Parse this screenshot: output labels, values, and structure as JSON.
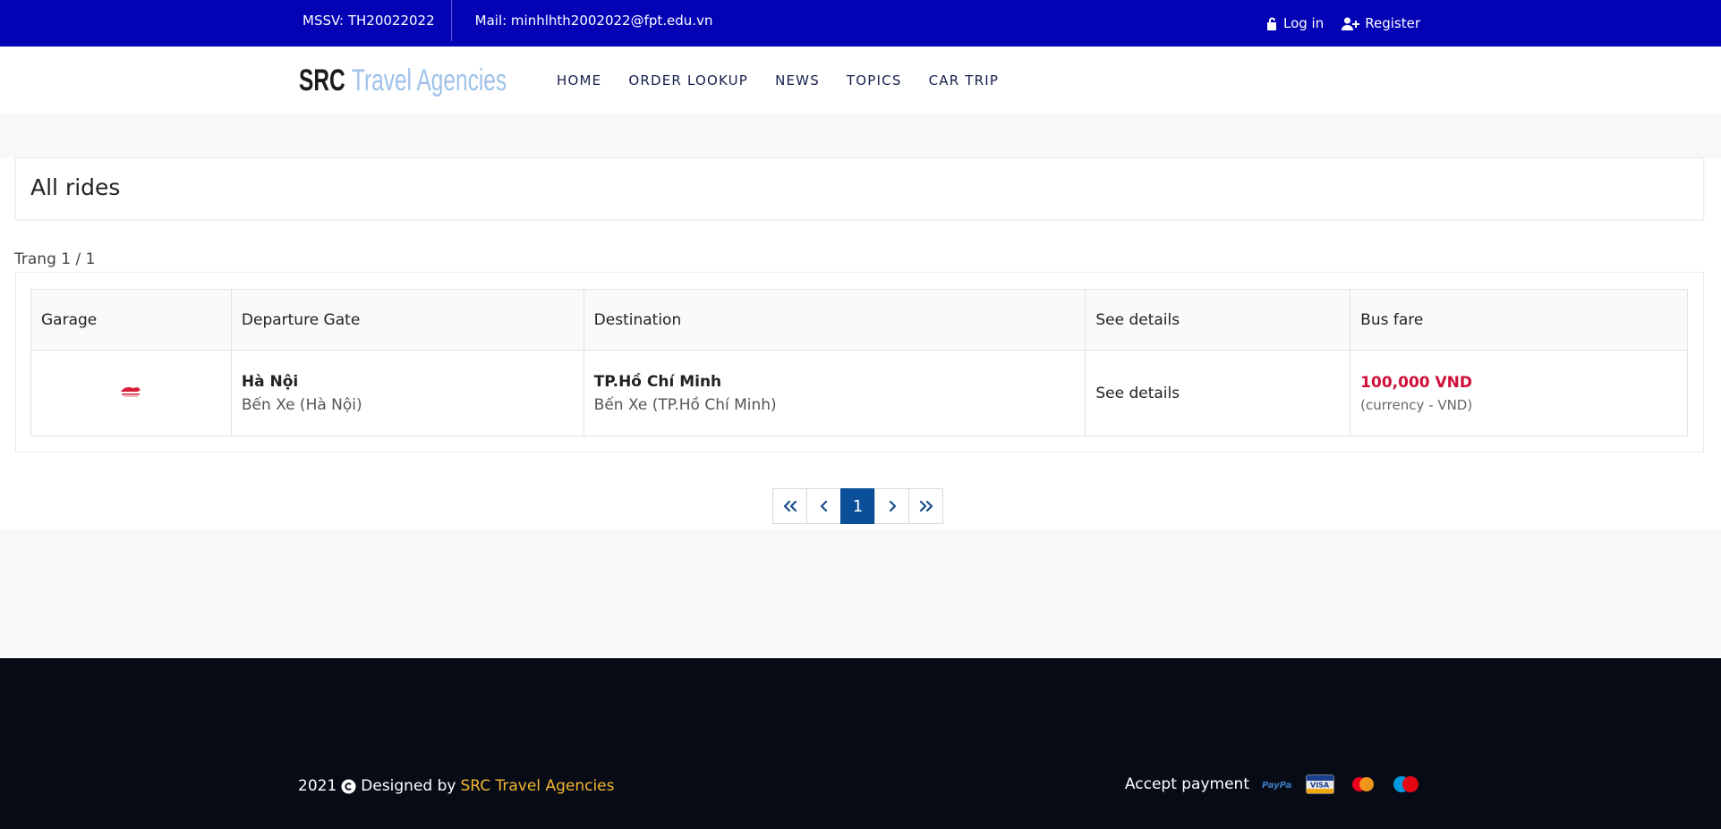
{
  "topbar": {
    "mssv": "MSSV: TH20022022",
    "mail": "Mail: minhlhth2002022@fpt.edu.vn",
    "login_label": "Log in",
    "register_label": "Register"
  },
  "header": {
    "logo_part1": "SRC",
    "logo_part2": "Travel Agencies",
    "nav": [
      "HOME",
      "ORDER LOOKUP",
      "NEWS",
      "TOPICS",
      "CAR TRIP"
    ]
  },
  "main": {
    "title": "All rides",
    "page_info": "Trang 1 / 1",
    "table": {
      "headers": [
        "Garage",
        "Departure Gate",
        "Destination",
        "See details",
        "Bus fare"
      ],
      "rows": [
        {
          "departure_city": "Hà Nội",
          "departure_station": "Bến Xe (Hà Nội)",
          "destination_city": "TP.Hồ Chí Minh",
          "destination_station": "Bến Xe (TP.Hồ Chí Minh)",
          "details_label": "See details",
          "price": "100,000 VND",
          "currency_note": "(currency - VND)"
        }
      ]
    },
    "pagination": {
      "current_page": "1"
    }
  },
  "footer": {
    "year": "2021",
    "designed_by": "Designed by",
    "brand": "SRC Travel Agencies",
    "accept_payment": "Accept payment",
    "payment_methods": [
      "PayPal",
      "VISA",
      "Mastercard",
      "Maestro"
    ]
  },
  "colors": {
    "topbar": "#0303b5",
    "price": "#d0103a",
    "pager_active": "#0b4f99",
    "footer_bg": "#070b16",
    "footer_brand": "#f4b731"
  }
}
